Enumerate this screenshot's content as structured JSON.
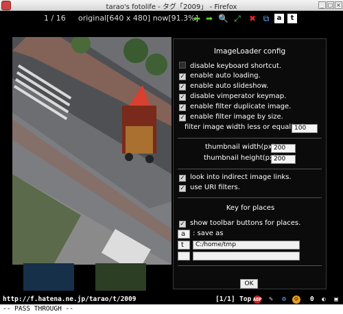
{
  "window": {
    "title": "tarao's fotolife - タグ「2009」 - Firefox"
  },
  "viewer": {
    "counter": "1 / 16",
    "image_info": "original[640 x 480] now[91.3%]",
    "toolbar_icons": [
      "prev-arrow-icon",
      "next-arrow-icon",
      "zoom-icon",
      "fit-icon",
      "close-icon",
      "copy-icon",
      "a-key-icon",
      "t-key-icon"
    ],
    "key_a": "a",
    "key_t": "t"
  },
  "config": {
    "title": "ImageLoader config",
    "options": [
      {
        "label": "disable keyboard shortcut.",
        "checked": false
      },
      {
        "label": "enable auto loading.",
        "checked": true
      },
      {
        "label": "enable auto slideshow.",
        "checked": true
      },
      {
        "label": "disable vimperator keymap.",
        "checked": true
      },
      {
        "label": "enable filter duplicate image.",
        "checked": true
      },
      {
        "label": "enable filter image by size.",
        "checked": true
      }
    ],
    "filter_label": "filter image width less or equal(px)",
    "filter_value": "100",
    "thumb_width_label": "thumbnail width(px)",
    "thumb_width_value": "200",
    "thumb_height_label": "thumbnail height(px)",
    "thumb_height_value": "200",
    "options2": [
      {
        "label": "look into indirect image links.",
        "checked": true
      },
      {
        "label": "use URI filters.",
        "checked": true
      }
    ],
    "places_title": "Key for places",
    "show_toolbar_label": "show toolbar buttons for places.",
    "places": [
      {
        "key": "a",
        "value": ": save as"
      },
      {
        "key": "t",
        "value": "C:/home/tmp"
      },
      {
        "key": "",
        "value": ""
      }
    ],
    "ok_label": "OK"
  },
  "statusbar": {
    "url": "http://f.hatena.ne.jp/tarao/t/2009",
    "position": "[1/1]",
    "top": "Top",
    "count": "0"
  },
  "cmdline": "-- PASS THROUGH --"
}
